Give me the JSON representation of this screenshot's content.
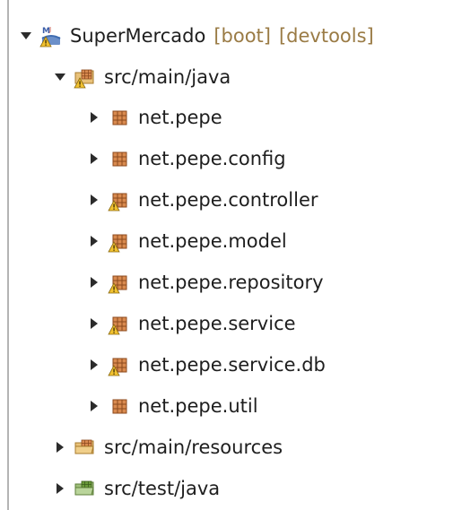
{
  "project": {
    "name": "SuperMercado",
    "decorations": [
      "[boot]",
      "[devtools]"
    ]
  },
  "tree": {
    "src_main_java": {
      "label": "src/main/java",
      "expanded": true
    },
    "packages": [
      {
        "label": "net.pepe",
        "warning": false
      },
      {
        "label": "net.pepe.config",
        "warning": false
      },
      {
        "label": "net.pepe.controller",
        "warning": true
      },
      {
        "label": "net.pepe.model",
        "warning": true
      },
      {
        "label": "net.pepe.repository",
        "warning": true
      },
      {
        "label": "net.pepe.service",
        "warning": true
      },
      {
        "label": "net.pepe.service.db",
        "warning": true
      },
      {
        "label": "net.pepe.util",
        "warning": false
      }
    ],
    "src_main_resources": {
      "label": "src/main/resources",
      "expanded": false
    },
    "src_test_java": {
      "label": "src/test/java",
      "expanded": false
    }
  },
  "icons": {
    "project": "maven-java-project-warning-icon",
    "source_folder": "source-folder-warning-icon",
    "package": "package-icon",
    "package_warning": "package-warning-icon",
    "resources_folder": "resources-folder-icon",
    "test_folder": "test-source-folder-icon"
  },
  "colors": {
    "text": "#1e1e1e",
    "decoration": "#9a7b45",
    "package": "#b5653a",
    "warning": "#f2c230"
  }
}
